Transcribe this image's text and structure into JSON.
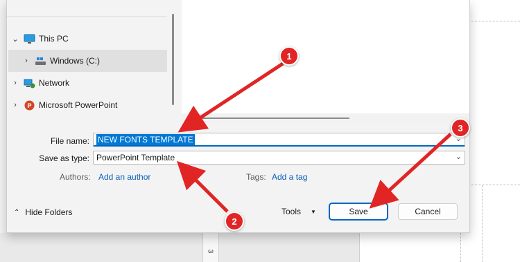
{
  "sidebar": {
    "items": [
      {
        "label": "This PC",
        "icon": "monitor-icon",
        "expanded": true
      },
      {
        "label": "Windows (C:)",
        "icon": "drive-icon",
        "selected": true
      },
      {
        "label": "Network",
        "icon": "network-icon"
      },
      {
        "label": "Microsoft PowerPoint",
        "icon": "powerpoint-icon"
      }
    ]
  },
  "form": {
    "file_name_label": "File name:",
    "file_name_value": "NEW FONTS TEMPLATE",
    "save_type_label": "Save as type:",
    "save_type_value": "PowerPoint Template",
    "authors_label": "Authors:",
    "authors_link": "Add an author",
    "tags_label": "Tags:",
    "tags_link": "Add a tag"
  },
  "footer": {
    "hide_folders_label": "Hide Folders",
    "tools_label": "Tools",
    "save_label": "Save",
    "cancel_label": "Cancel"
  },
  "background": {
    "ruler_number": "3"
  },
  "annotations": {
    "badges": [
      "1",
      "2",
      "3"
    ],
    "accent_color": "#e12525"
  }
}
